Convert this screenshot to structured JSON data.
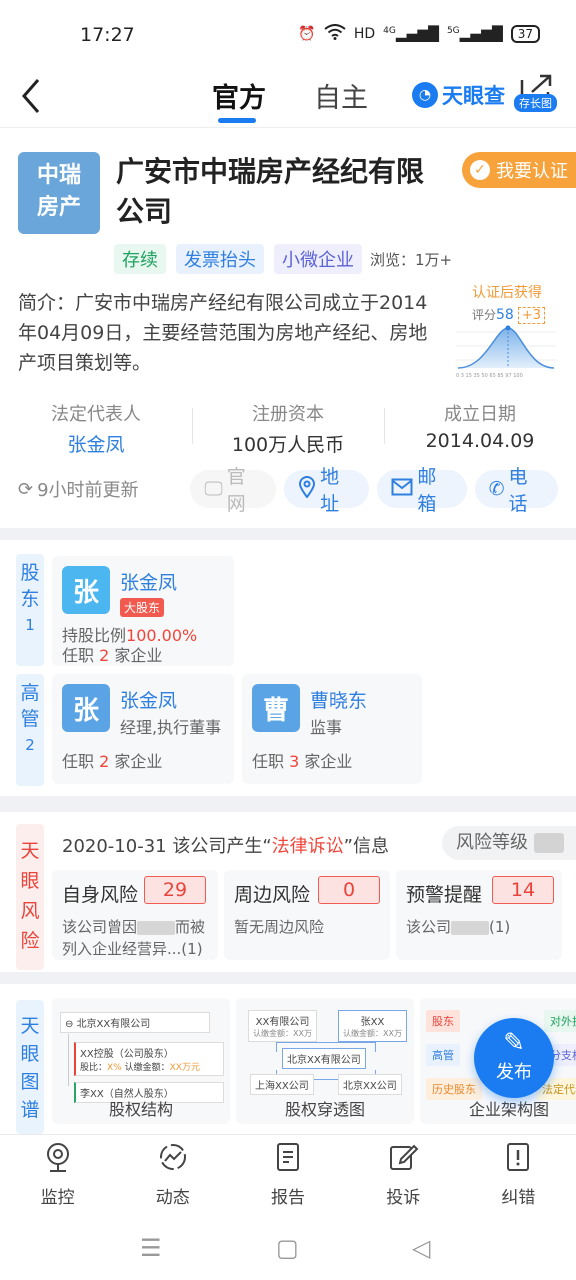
{
  "status": {
    "time": "17:27",
    "network": "HD",
    "signal1": "4G",
    "signal2": "5G",
    "battery": "37"
  },
  "nav": {
    "tabs": [
      "官方",
      "自主"
    ],
    "active_tab": 0,
    "brand": "天眼查",
    "share_label": "存长图"
  },
  "company": {
    "logo_text": "中瑞\n房产",
    "logo_line1": "中瑞",
    "logo_line2": "房产",
    "name": "广安市中瑞房产经纪有限公司",
    "verify_label": "我要认证",
    "tags": [
      "存续",
      "发票抬头",
      "小微企业"
    ],
    "views": "浏览：1万+",
    "intro": "简介：广安市中瑞房产经纪有限公司成立于2014年04月09日，主要经营范围为房地产经纪、房地产项目策划等。",
    "score": {
      "title": "认证后获得",
      "label": "评分",
      "value": "58",
      "plus": "+3",
      "axis": [
        "0",
        "3",
        "15",
        "35",
        "50",
        "65",
        "85",
        "97",
        "100"
      ]
    },
    "facts": [
      {
        "key": "法定代表人",
        "value": "张金凤"
      },
      {
        "key": "注册资本",
        "value": "100万人民币"
      },
      {
        "key": "成立日期",
        "value": "2014.04.09"
      }
    ],
    "updated": "9小时前更新",
    "actions": [
      "官网",
      "地址",
      "邮箱",
      "电话"
    ]
  },
  "shareholders": {
    "label": "股东",
    "count": "1",
    "items": [
      {
        "avatar": "张",
        "name": "张金凤",
        "badge": "大股东",
        "ratio_label": "持股比例",
        "ratio": "100.00%",
        "office_prefix": "任职",
        "office_count": "2",
        "office_suffix": "家企业"
      }
    ]
  },
  "executives": {
    "label": "高管",
    "count": "2",
    "items": [
      {
        "avatar": "张",
        "name": "张金凤",
        "role": "经理,执行董事",
        "office_prefix": "任职",
        "office_count": "2",
        "office_suffix": "家企业"
      },
      {
        "avatar": "曹",
        "name": "曹晓东",
        "role": "监事",
        "office_prefix": "任职",
        "office_count": "3",
        "office_suffix": "家企业"
      }
    ]
  },
  "risk": {
    "label": "天眼风险",
    "headline_pre": "2020-10-31 该公司产生“",
    "headline_hl": "法律诉讼",
    "headline_post": "”信息",
    "level_label": "风险等级",
    "cards": [
      {
        "title": "自身风险",
        "count": "29",
        "desc1_pre": "该公司曾因",
        "desc1_post": "而被",
        "desc2": "列入企业经营异...(1)"
      },
      {
        "title": "周边风险",
        "count": "0",
        "desc1": "暂无周边风险"
      },
      {
        "title": "预警提醒",
        "count": "14",
        "desc1_pre": "该公司",
        "desc1_post": "(1)"
      }
    ]
  },
  "graph": {
    "label": "天眼图谱",
    "cards": [
      {
        "label": "股权结构",
        "root": "北京XX有限公司",
        "n1": "XX控股（公司股东）",
        "n1a": "股比：",
        "n1b": "X%",
        "n1c": "认缴金额：",
        "n1d": "XX万元",
        "n2": "李XX（自然人股东）"
      },
      {
        "label": "股权穿透图",
        "a": "XX有限公司",
        "a_sub": "认缴金额：XX万",
        "b": "张XX",
        "b_sub": "认缴金额：XX万",
        "root": "北京XX有限公司",
        "c": "上海XX公司",
        "d": "北京XX公司"
      },
      {
        "label": "企业架构图",
        "chips": [
          "股东",
          "对外投",
          "高管",
          "分支机",
          "历史股东",
          "法定代表"
        ]
      }
    ]
  },
  "fab": {
    "label": "发布"
  },
  "tabbar": [
    "监控",
    "动态",
    "报告",
    "投诉",
    "纠错"
  ]
}
